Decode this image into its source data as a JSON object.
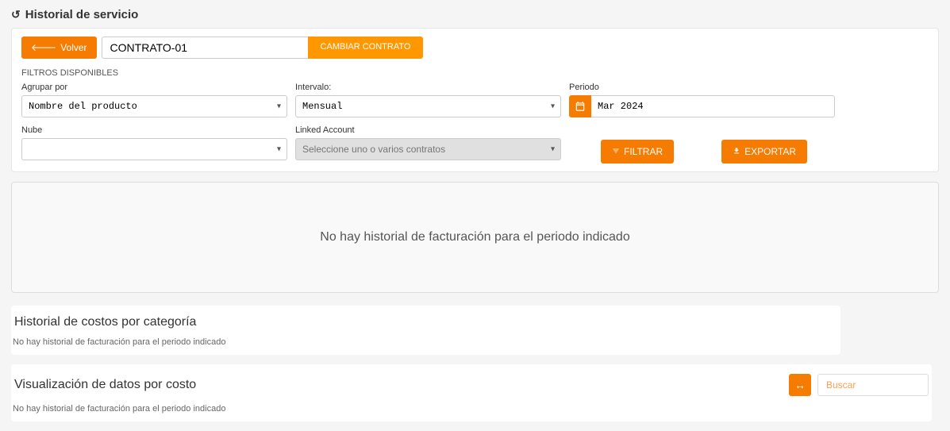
{
  "header": {
    "title": "Historial de servicio"
  },
  "topbar": {
    "back_label": "Volver",
    "contract_value": "CONTRATO-01",
    "change_contract_label": "CAMBIAR CONTRATO"
  },
  "filters": {
    "section_label": "FILTROS DISPONIBLES",
    "group_by": {
      "label": "Agrupar por",
      "value": "Nombre del producto"
    },
    "interval": {
      "label": "Intervalo:",
      "value": "Mensual"
    },
    "period": {
      "label": "Periodo",
      "value": "Mar 2024"
    },
    "cloud": {
      "label": "Nube",
      "value": ""
    },
    "linked_account": {
      "label": "Linked Account",
      "placeholder": "Seleccione uno o varios contratos"
    },
    "filter_button": "FILTRAR",
    "export_button": "EXPORTAR"
  },
  "hero": {
    "message": "No hay historial de facturación para el periodo indicado"
  },
  "sections": {
    "category": {
      "title": "Historial de costos por categoría",
      "note": "No hay historial de facturación para el periodo indicado"
    },
    "cost_viz": {
      "title": "Visualización de datos por costo",
      "note": "No hay historial de facturación para el periodo indicado",
      "search_placeholder": "Buscar"
    }
  }
}
